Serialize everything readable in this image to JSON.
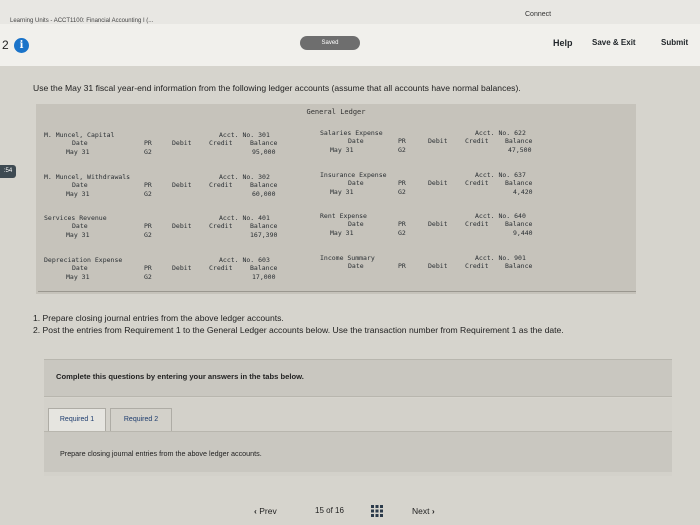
{
  "header": {
    "breadcrumb": "Learning Units - ACCT1100: Financial Accounting I (...",
    "connect": "Connect"
  },
  "toolbar": {
    "question_number": "2",
    "info_glyph": "i",
    "saved": "Saved",
    "help": "Help",
    "save_exit": "Save & Exit",
    "submit": "Submit"
  },
  "timer": ":54",
  "instruction": "Use the May 31 fiscal year-end information from the following ledger accounts (assume that all accounts have normal balances).",
  "ledger": {
    "title": "General Ledger",
    "headers": {
      "date": "Date",
      "pr": "PR",
      "debit": "Debit",
      "credit": "Credit",
      "balance": "Balance"
    },
    "accounts": [
      {
        "name": "M. Muncel, Capital",
        "no": "Acct. No. 301",
        "date": "May 31",
        "pr": "G2",
        "balance": "95,000"
      },
      {
        "name": "Salaries Expense",
        "no": "Acct. No. 622",
        "date": "May 31",
        "pr": "G2",
        "balance": "47,500"
      },
      {
        "name": "M. Muncel, Withdrawals",
        "no": "Acct. No. 302",
        "date": "May 31",
        "pr": "G2",
        "balance": "60,000"
      },
      {
        "name": "Insurance Expense",
        "no": "Acct. No. 637",
        "date": "May 31",
        "pr": "G2",
        "balance": "4,420"
      },
      {
        "name": "Services Revenue",
        "no": "Acct. No. 401",
        "date": "May 31",
        "pr": "G2",
        "balance": "167,390"
      },
      {
        "name": "Rent Expense",
        "no": "Acct. No. 640",
        "date": "May 31",
        "pr": "G2",
        "balance": "9,440"
      },
      {
        "name": "Depreciation Expense",
        "no": "Acct. No. 603",
        "date": "May 31",
        "pr": "G2",
        "balance": "17,000"
      },
      {
        "name": "Income Summary",
        "no": "Acct. No. 901",
        "date": "",
        "pr": "",
        "balance": ""
      }
    ]
  },
  "requirements": {
    "r1": "1. Prepare closing journal entries from the above ledger accounts.",
    "r2": "2. Post the entries from Requirement 1 to the General Ledger accounts below. Use the transaction number from Requirement 1 as the date."
  },
  "complete_prompt": "Complete this questions by entering your answers in the tabs below.",
  "tabs": {
    "required1": "Required 1",
    "required2": "Required 2"
  },
  "tab_content": "Prepare closing journal entries from the above ledger accounts.",
  "pager": {
    "prev": "Prev",
    "current": "15",
    "of": "of",
    "total": "16",
    "next": "Next"
  }
}
